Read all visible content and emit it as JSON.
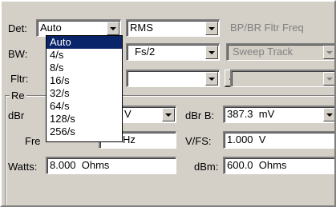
{
  "det": {
    "label": "Det:",
    "value": "Auto",
    "mode": "RMS"
  },
  "bpbr": {
    "label": "BP/BR Fltr Freq",
    "value": "Sweep Track"
  },
  "bw": {
    "label": "BW:",
    "value": "Fs/2"
  },
  "fltr": {
    "label": "Fltr:",
    "browse_label": "..."
  },
  "group": {
    "title": "Re"
  },
  "dbr_a": {
    "label": "dBr",
    "unit": "V"
  },
  "dbr_b": {
    "label": "dBr B:",
    "value": "387.3  mV"
  },
  "freq": {
    "label": "Fre",
    "unit": "Hz"
  },
  "vfs": {
    "label": "V/FS:",
    "value": "1.000  V"
  },
  "watts": {
    "label": "Watts:",
    "value": "8.000  Ohms"
  },
  "dbm": {
    "label": "dBm:",
    "value": "600.0  Ohms"
  },
  "dropdown": {
    "items": [
      "Auto",
      "4/s",
      "8/s",
      "16/s",
      "32/s",
      "64/s",
      "128/s",
      "256/s"
    ],
    "selected_index": 0
  },
  "colors": {
    "face": "#d4d0c8",
    "selection": "#0a246a",
    "disabled_text": "#808080"
  }
}
